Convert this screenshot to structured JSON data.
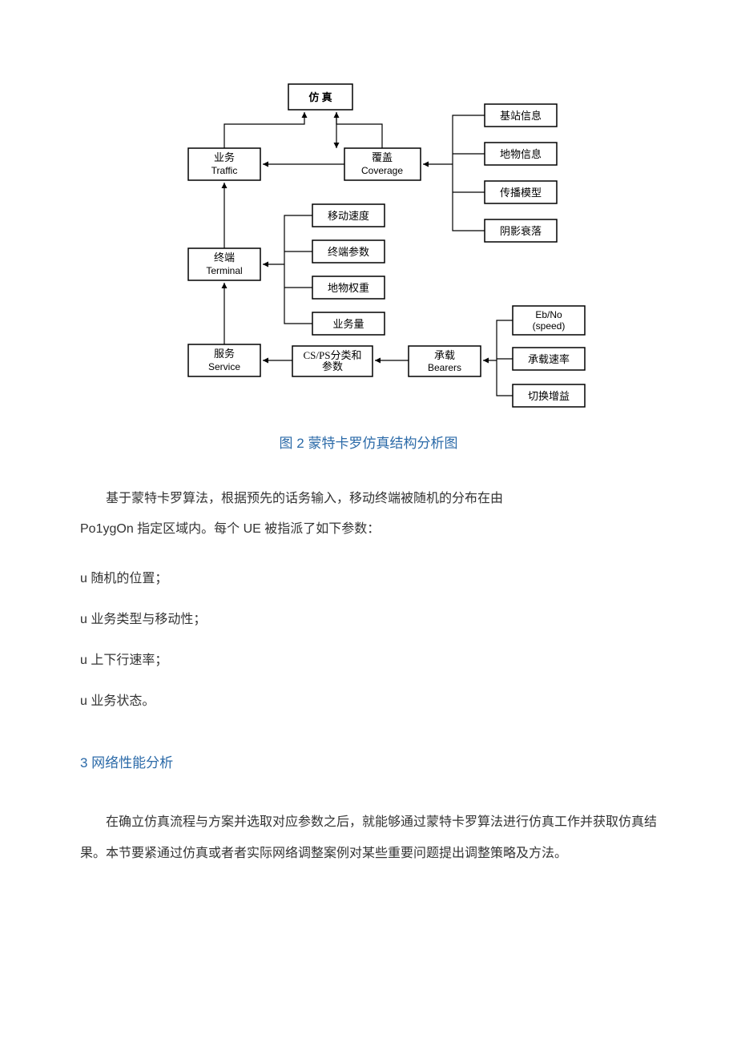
{
  "diagram": {
    "nodes": {
      "sim": "仿 真",
      "traffic_cn": "业务",
      "traffic_en": "Traffic",
      "coverage_cn": "覆盖",
      "coverage_en": "Coverage",
      "bs_info": "基站信息",
      "clutter_info": "地物信息",
      "prop_model": "传播模型",
      "shadow": "阴影衰落",
      "terminal_cn": "终端",
      "terminal_en": "Terminal",
      "move_speed": "移动速度",
      "term_params": "终端参数",
      "clutter_weight": "地物权重",
      "traffic_volume": "业务量",
      "service_cn": "服务",
      "service_en": "Service",
      "csps": "CS/PS分类和",
      "csps2": "参数",
      "bearers_cn": "承载",
      "bearers_en": "Bearers",
      "ebno": "Eb/No",
      "ebno2": "(speed)",
      "bearer_rate": "承载速率",
      "ho_gain": "切换增益"
    }
  },
  "caption": "图 2 蒙特卡罗仿真结构分析图",
  "para1_line1": "基于蒙特卡罗算法，根据预先的话务输入，移动终端被随机的分布在由",
  "para1_line2": "Po1ygOn 指定区域内。每个 UE 被指派了如下参数：",
  "list": {
    "i1": "u 随机的位置；",
    "i2": "u 业务类型与移动性；",
    "i3": "u 上下行速率；",
    "i4": "u 业务状态。"
  },
  "section3": "3 网络性能分析",
  "para2": "在确立仿真流程与方案并选取对应参数之后，就能够通过蒙特卡罗算法进行仿真工作并获取仿真结果。本节要紧通过仿真或者者实际网络调整案例对某些重要问题提出调整策略及方法。"
}
